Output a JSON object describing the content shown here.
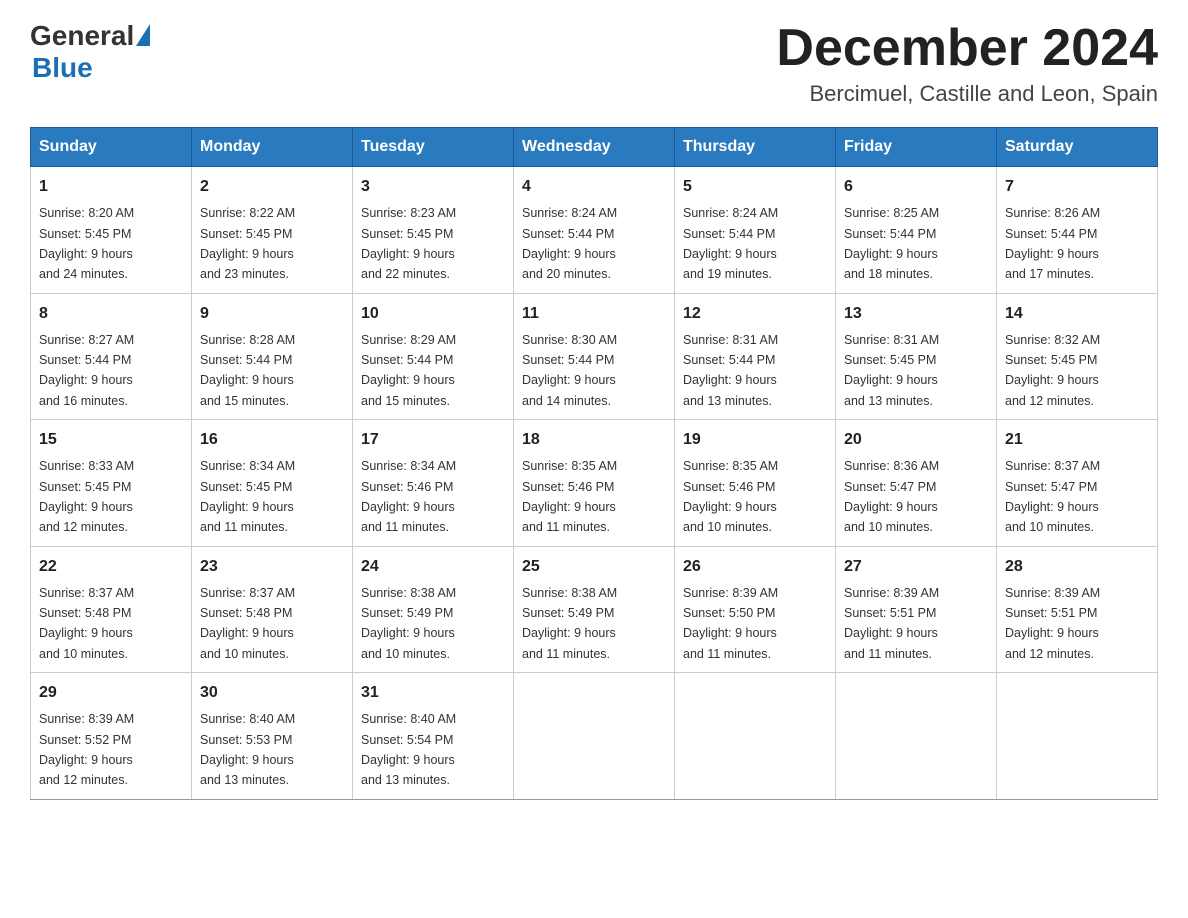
{
  "logo": {
    "general": "General",
    "blue": "Blue"
  },
  "title": "December 2024",
  "subtitle": "Bercimuel, Castille and Leon, Spain",
  "weekdays": [
    "Sunday",
    "Monday",
    "Tuesday",
    "Wednesday",
    "Thursday",
    "Friday",
    "Saturday"
  ],
  "weeks": [
    [
      {
        "day": "1",
        "sunrise": "8:20 AM",
        "sunset": "5:45 PM",
        "daylight": "9 hours and 24 minutes."
      },
      {
        "day": "2",
        "sunrise": "8:22 AM",
        "sunset": "5:45 PM",
        "daylight": "9 hours and 23 minutes."
      },
      {
        "day": "3",
        "sunrise": "8:23 AM",
        "sunset": "5:45 PM",
        "daylight": "9 hours and 22 minutes."
      },
      {
        "day": "4",
        "sunrise": "8:24 AM",
        "sunset": "5:44 PM",
        "daylight": "9 hours and 20 minutes."
      },
      {
        "day": "5",
        "sunrise": "8:24 AM",
        "sunset": "5:44 PM",
        "daylight": "9 hours and 19 minutes."
      },
      {
        "day": "6",
        "sunrise": "8:25 AM",
        "sunset": "5:44 PM",
        "daylight": "9 hours and 18 minutes."
      },
      {
        "day": "7",
        "sunrise": "8:26 AM",
        "sunset": "5:44 PM",
        "daylight": "9 hours and 17 minutes."
      }
    ],
    [
      {
        "day": "8",
        "sunrise": "8:27 AM",
        "sunset": "5:44 PM",
        "daylight": "9 hours and 16 minutes."
      },
      {
        "day": "9",
        "sunrise": "8:28 AM",
        "sunset": "5:44 PM",
        "daylight": "9 hours and 15 minutes."
      },
      {
        "day": "10",
        "sunrise": "8:29 AM",
        "sunset": "5:44 PM",
        "daylight": "9 hours and 15 minutes."
      },
      {
        "day": "11",
        "sunrise": "8:30 AM",
        "sunset": "5:44 PM",
        "daylight": "9 hours and 14 minutes."
      },
      {
        "day": "12",
        "sunrise": "8:31 AM",
        "sunset": "5:44 PM",
        "daylight": "9 hours and 13 minutes."
      },
      {
        "day": "13",
        "sunrise": "8:31 AM",
        "sunset": "5:45 PM",
        "daylight": "9 hours and 13 minutes."
      },
      {
        "day": "14",
        "sunrise": "8:32 AM",
        "sunset": "5:45 PM",
        "daylight": "9 hours and 12 minutes."
      }
    ],
    [
      {
        "day": "15",
        "sunrise": "8:33 AM",
        "sunset": "5:45 PM",
        "daylight": "9 hours and 12 minutes."
      },
      {
        "day": "16",
        "sunrise": "8:34 AM",
        "sunset": "5:45 PM",
        "daylight": "9 hours and 11 minutes."
      },
      {
        "day": "17",
        "sunrise": "8:34 AM",
        "sunset": "5:46 PM",
        "daylight": "9 hours and 11 minutes."
      },
      {
        "day": "18",
        "sunrise": "8:35 AM",
        "sunset": "5:46 PM",
        "daylight": "9 hours and 11 minutes."
      },
      {
        "day": "19",
        "sunrise": "8:35 AM",
        "sunset": "5:46 PM",
        "daylight": "9 hours and 10 minutes."
      },
      {
        "day": "20",
        "sunrise": "8:36 AM",
        "sunset": "5:47 PM",
        "daylight": "9 hours and 10 minutes."
      },
      {
        "day": "21",
        "sunrise": "8:37 AM",
        "sunset": "5:47 PM",
        "daylight": "9 hours and 10 minutes."
      }
    ],
    [
      {
        "day": "22",
        "sunrise": "8:37 AM",
        "sunset": "5:48 PM",
        "daylight": "9 hours and 10 minutes."
      },
      {
        "day": "23",
        "sunrise": "8:37 AM",
        "sunset": "5:48 PM",
        "daylight": "9 hours and 10 minutes."
      },
      {
        "day": "24",
        "sunrise": "8:38 AM",
        "sunset": "5:49 PM",
        "daylight": "9 hours and 10 minutes."
      },
      {
        "day": "25",
        "sunrise": "8:38 AM",
        "sunset": "5:49 PM",
        "daylight": "9 hours and 11 minutes."
      },
      {
        "day": "26",
        "sunrise": "8:39 AM",
        "sunset": "5:50 PM",
        "daylight": "9 hours and 11 minutes."
      },
      {
        "day": "27",
        "sunrise": "8:39 AM",
        "sunset": "5:51 PM",
        "daylight": "9 hours and 11 minutes."
      },
      {
        "day": "28",
        "sunrise": "8:39 AM",
        "sunset": "5:51 PM",
        "daylight": "9 hours and 12 minutes."
      }
    ],
    [
      {
        "day": "29",
        "sunrise": "8:39 AM",
        "sunset": "5:52 PM",
        "daylight": "9 hours and 12 minutes."
      },
      {
        "day": "30",
        "sunrise": "8:40 AM",
        "sunset": "5:53 PM",
        "daylight": "9 hours and 13 minutes."
      },
      {
        "day": "31",
        "sunrise": "8:40 AM",
        "sunset": "5:54 PM",
        "daylight": "9 hours and 13 minutes."
      },
      null,
      null,
      null,
      null
    ]
  ],
  "labels": {
    "sunrise": "Sunrise:",
    "sunset": "Sunset:",
    "daylight": "Daylight:"
  }
}
